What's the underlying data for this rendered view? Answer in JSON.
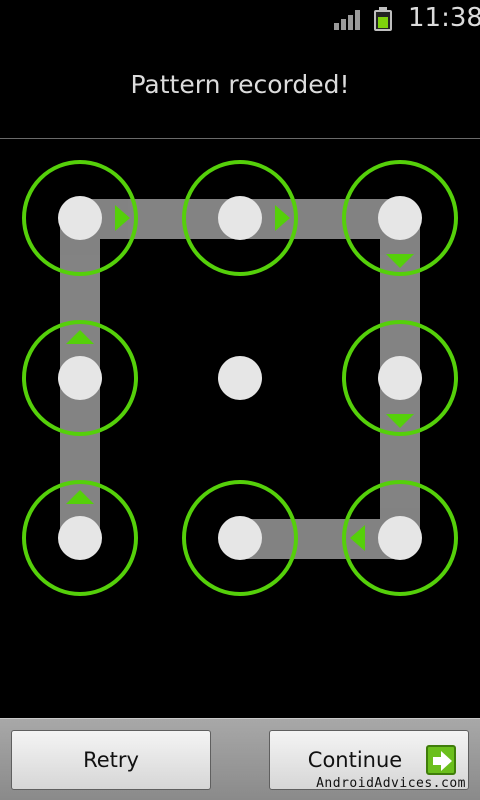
{
  "status_bar": {
    "time": "11:38",
    "signal_icon": "signal-bars-icon",
    "battery_icon": "battery-charging-icon",
    "battery_color": "#7ed10c"
  },
  "header": {
    "message": "Pattern recorded!"
  },
  "pattern": {
    "selected_dots": [
      1,
      2,
      3,
      6,
      9,
      8,
      4,
      7
    ],
    "path": [
      "top-left",
      "top-center",
      "top-right",
      "middle-right",
      "bottom-right",
      "bottom-center"
    ],
    "second_path": [
      "bottom-left",
      "middle-left",
      "top-left"
    ],
    "ring_color": "#55d00a",
    "arrow_color": "#55d00a",
    "dot_color": "#e6e6e6",
    "line_color": "#8a8a8a"
  },
  "buttons": {
    "retry_label": "Retry",
    "continue_label": "Continue",
    "continue_icon": "arrow-right-icon"
  },
  "watermark": "AndroidAdvices.com"
}
